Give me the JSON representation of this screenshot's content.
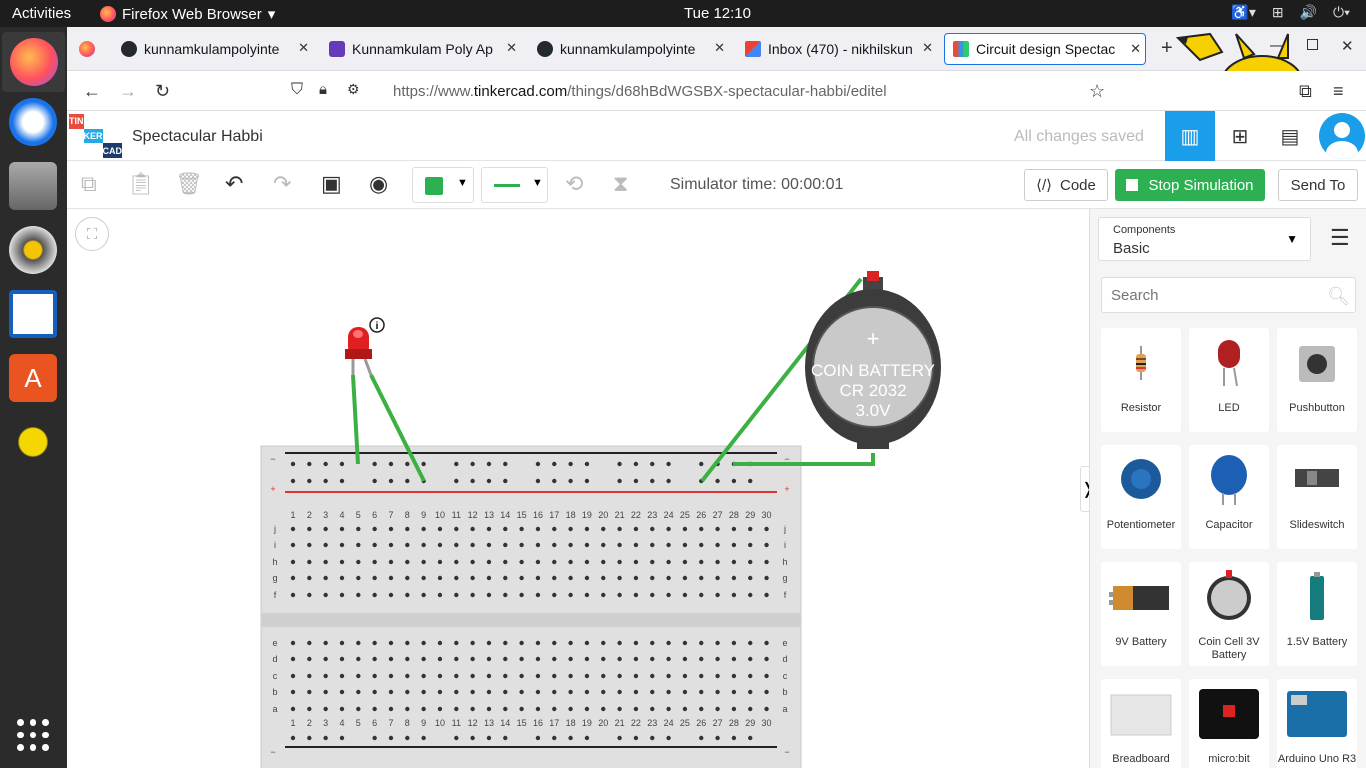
{
  "system": {
    "activities": "Activities",
    "app_name": "Firefox Web Browser",
    "clock": "Tue 12:10"
  },
  "tabs": [
    {
      "title": "kunnamkulampolyinte",
      "icon": "github-icon"
    },
    {
      "title": "Kunnamkulam Poly Ap",
      "icon": "forms-icon"
    },
    {
      "title": "kunnamkulampolyinte",
      "icon": "github-icon"
    },
    {
      "title": "Inbox (470) - nikhilskun",
      "icon": "gmail-icon"
    },
    {
      "title": "Circuit design Spectac",
      "icon": "tinkercad-icon",
      "active": true
    }
  ],
  "url": {
    "prefix": "https://www.",
    "domain": "tinkercad.com",
    "path": "/things/d68hBdWGSBX-spectacular-habbi/editel"
  },
  "header": {
    "logo_letters": [
      "TIN",
      "KER",
      "CAD"
    ],
    "project_name": "Spectacular Habbi",
    "save_status": "All changes saved"
  },
  "toolbar": {
    "sim_time": "Simulator time: 00:00:01",
    "code_label": "Code",
    "stop_label": "Stop Simulation",
    "send_label": "Send To",
    "color": "#2db052"
  },
  "panel": {
    "components_label": "Components",
    "components_value": "Basic",
    "search_placeholder": "Search",
    "items": [
      {
        "label": "Resistor"
      },
      {
        "label": "LED"
      },
      {
        "label": "Pushbutton"
      },
      {
        "label": "Potentiometer"
      },
      {
        "label": "Capacitor"
      },
      {
        "label": "Slideswitch"
      },
      {
        "label": "9V Battery"
      },
      {
        "label": "Coin Cell 3V Battery"
      },
      {
        "label": "1.5V Battery"
      },
      {
        "label": "Breadboard"
      },
      {
        "label": "micro:bit"
      },
      {
        "label": "Arduino Uno R3"
      }
    ]
  },
  "circuit": {
    "battery_lines": [
      "COIN BATTERY",
      "CR 2032",
      "3.0V"
    ],
    "plus_sign": "+",
    "row_letters_top": [
      "j",
      "i",
      "h",
      "g",
      "f"
    ],
    "row_letters_bottom": [
      "e",
      "d",
      "c",
      "b",
      "a"
    ],
    "wire_color": "#3cb043",
    "led_color": "#e02020"
  }
}
